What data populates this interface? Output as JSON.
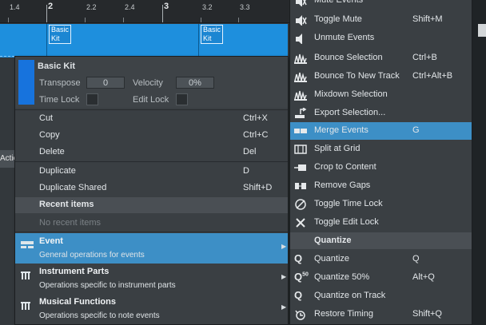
{
  "ruler": {
    "ticks": [
      {
        "label": "1.4",
        "major": false
      },
      {
        "label": "2",
        "major": true
      },
      {
        "label": "2.2",
        "major": false
      },
      {
        "label": "2.4",
        "major": false
      },
      {
        "label": "3",
        "major": true
      },
      {
        "label": "3.2",
        "major": false
      },
      {
        "label": "3.3",
        "major": false
      }
    ]
  },
  "track": {
    "events": [
      "Basic Kit",
      "Basic Kit"
    ]
  },
  "action_stub": "Actio",
  "event_header": {
    "title": "Basic Kit",
    "transpose_label": "Transpose",
    "transpose_value": "0",
    "velocity_label": "Velocity",
    "velocity_value": "0%",
    "timelock_label": "Time Lock",
    "editlock_label": "Edit Lock",
    "color": "#1773dd"
  },
  "menu": {
    "edit_items": [
      {
        "label": "Cut",
        "shortcut": "Ctrl+X"
      },
      {
        "label": "Copy",
        "shortcut": "Ctrl+C"
      },
      {
        "label": "Delete",
        "shortcut": "Del"
      }
    ],
    "dup_items": [
      {
        "label": "Duplicate",
        "shortcut": "D"
      },
      {
        "label": "Duplicate Shared",
        "shortcut": "Shift+D"
      }
    ],
    "recent_header": "Recent items",
    "recent_empty": "No recent items",
    "submenus": [
      {
        "title": "Event",
        "desc": "General operations for events",
        "icon": "event-icon"
      },
      {
        "title": "Instrument Parts",
        "desc": "Operations specific to instrument parts",
        "icon": "instrument-icon"
      },
      {
        "title": "Musical Functions",
        "desc": "Operations specific to note events",
        "icon": "instrument-icon"
      }
    ]
  },
  "submenu": {
    "items_top": [
      {
        "label": "Mute Events",
        "shortcut": "",
        "icon": "mute-icon"
      },
      {
        "label": "Toggle Mute",
        "shortcut": "Shift+M",
        "icon": "mute-icon"
      },
      {
        "label": "Unmute Events",
        "shortcut": "",
        "icon": "speaker-icon"
      },
      {
        "label": "Bounce Selection",
        "shortcut": "Ctrl+B",
        "icon": "waveform-icon"
      },
      {
        "label": "Bounce To New Track",
        "shortcut": "Ctrl+Alt+B",
        "icon": "waveform-icon"
      },
      {
        "label": "Mixdown Selection",
        "shortcut": "",
        "icon": "waveform-icon"
      },
      {
        "label": "Export Selection...",
        "shortcut": "",
        "icon": "export-icon"
      },
      {
        "label": "Merge Events",
        "shortcut": "G",
        "icon": "merge-icon"
      },
      {
        "label": "Split at Grid",
        "shortcut": "",
        "icon": "split-icon"
      },
      {
        "label": "Crop to Content",
        "shortcut": "",
        "icon": "crop-icon"
      },
      {
        "label": "Remove Gaps",
        "shortcut": "",
        "icon": "gaps-icon"
      },
      {
        "label": "Toggle Time Lock",
        "shortcut": "",
        "icon": "timelock-icon"
      },
      {
        "label": "Toggle Edit Lock",
        "shortcut": "",
        "icon": "editlock-icon"
      }
    ],
    "quantize_header": "Quantize",
    "items_quantize": [
      {
        "label": "Quantize",
        "shortcut": "Q",
        "glyph": "Q"
      },
      {
        "label": "Quantize 50%",
        "shortcut": "Alt+Q",
        "glyph": "Q50"
      },
      {
        "label": "Quantize on Track",
        "shortcut": "",
        "glyph": "Q"
      },
      {
        "label": "Restore Timing",
        "shortcut": "Shift+Q",
        "glyph": "restore"
      }
    ]
  },
  "colors": {
    "accent": "#3d8fc6",
    "track": "#1e8fdd",
    "menu_bg": "#3a3f43"
  }
}
